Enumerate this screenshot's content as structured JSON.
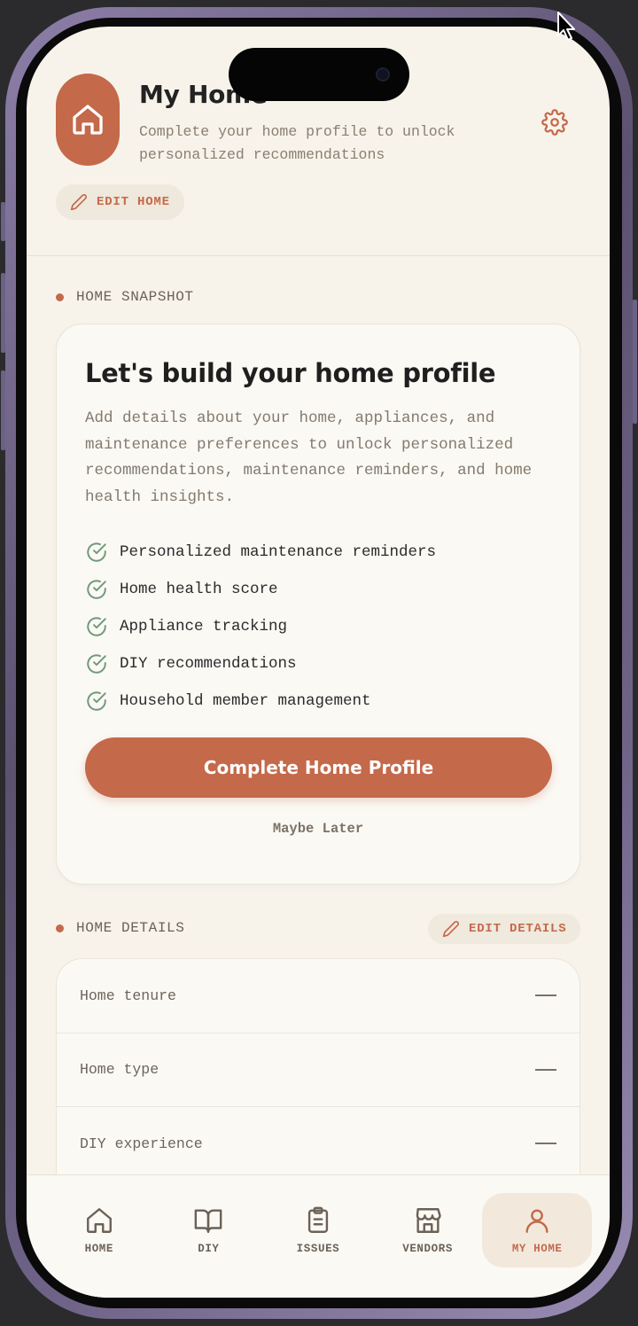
{
  "header": {
    "title": "My Home",
    "subtitle": "Complete your home profile to unlock personalized recommendations",
    "edit_home_label": "EDIT HOME"
  },
  "snapshot": {
    "section_label": "HOME SNAPSHOT",
    "card_title": "Let's build your home profile",
    "card_description": "Add details about your home, appliances, and maintenance preferences to unlock personalized recommendations, maintenance reminders, and home health insights.",
    "benefits": [
      "Personalized maintenance reminders",
      "Home health score",
      "Appliance tracking",
      "DIY recommendations",
      "Household member management"
    ],
    "primary_button": "Complete Home Profile",
    "secondary_button": "Maybe Later"
  },
  "details": {
    "section_label": "HOME DETAILS",
    "edit_label": "EDIT DETAILS",
    "rows": [
      {
        "label": "Home tenure",
        "value": "—"
      },
      {
        "label": "Home type",
        "value": "—"
      },
      {
        "label": "DIY experience",
        "value": "—"
      }
    ]
  },
  "tabbar": {
    "tabs": [
      {
        "label": "HOME",
        "icon": "house-icon",
        "active": false
      },
      {
        "label": "DIY",
        "icon": "book-icon",
        "active": false
      },
      {
        "label": "ISSUES",
        "icon": "clipboard-icon",
        "active": false
      },
      {
        "label": "VENDORS",
        "icon": "storefront-icon",
        "active": false
      },
      {
        "label": "MY HOME",
        "icon": "user-icon",
        "active": true
      }
    ]
  },
  "colors": {
    "accent": "#c4694a",
    "background": "#f7f3ea",
    "check_green": "#6f9a7a"
  }
}
